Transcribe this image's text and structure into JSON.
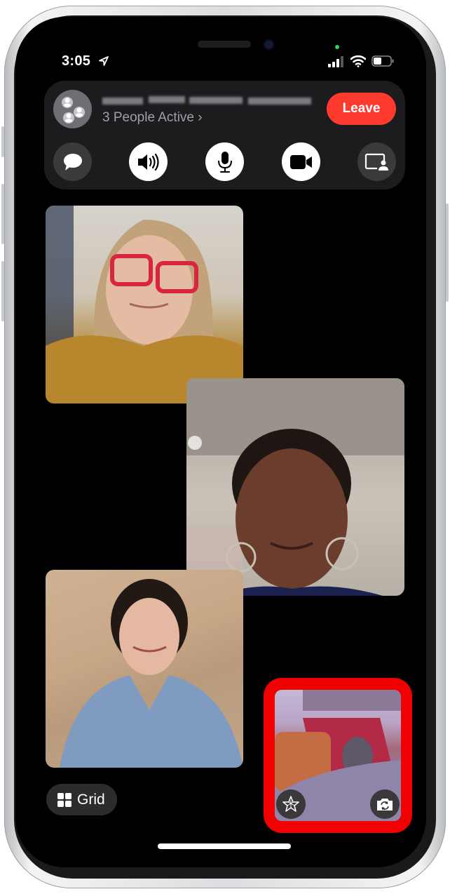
{
  "status_bar": {
    "time": "3:05",
    "location_icon": "location-arrow-icon",
    "signal_icon": "cellular-signal-icon",
    "wifi_icon": "wifi-icon",
    "battery_icon": "battery-icon",
    "camera_in_use_indicator": "green-dot"
  },
  "call_panel": {
    "group_icon": "group-people-icon",
    "title": "[redacted / pixelated]",
    "subtitle": "3 People Active",
    "subtitle_chevron": "›",
    "leave_label": "Leave",
    "colors": {
      "leave": "#ff3b30",
      "panel": "#1c1c1e"
    },
    "controls": [
      {
        "name": "messages",
        "icon": "message-bubble-icon",
        "style": "dark"
      },
      {
        "name": "speaker",
        "icon": "speaker-wave-icon",
        "style": "light"
      },
      {
        "name": "microphone",
        "icon": "microphone-icon",
        "style": "light"
      },
      {
        "name": "camera",
        "icon": "video-camera-icon",
        "style": "light"
      },
      {
        "name": "shareplay",
        "icon": "screen-share-person-icon",
        "style": "dark"
      }
    ]
  },
  "participants": [
    {
      "name": "participant-1",
      "description": "Woman with red glasses and mustard sweater"
    },
    {
      "name": "participant-2",
      "description": "Woman with twists and hoop earrings"
    },
    {
      "name": "participant-3",
      "description": "Woman with short dark hair in blue sweater"
    }
  ],
  "self_view": {
    "description": "Self camera preview showing a gray cat on a blanket",
    "highlight_color": "#f00000",
    "effects_icon": "effects-star-icon",
    "flip_camera_icon": "camera-flip-icon"
  },
  "grid_button": {
    "label": "Grid",
    "icon": "grid-icon"
  }
}
